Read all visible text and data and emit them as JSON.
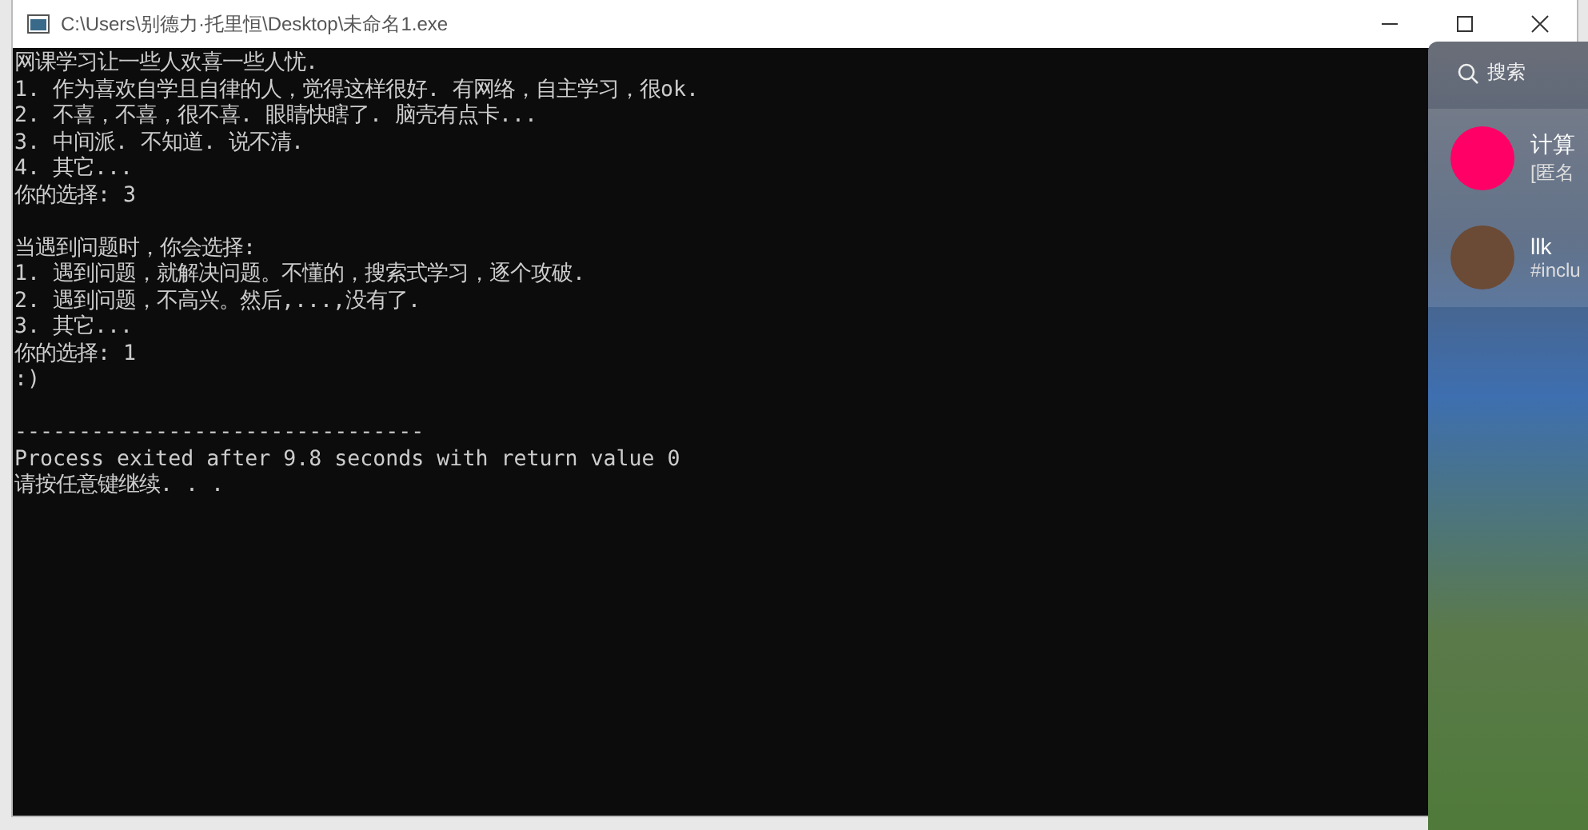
{
  "window": {
    "title": "C:\\Users\\别德力·托里恒\\Desktop\\未命名1.exe"
  },
  "console": {
    "blocks": [
      [
        "网课学习让一些人欢喜一些人忧.",
        "1. 作为喜欢自学且自律的人，觉得这样很好. 有网络，自主学习，很ok.",
        "2. 不喜，不喜，很不喜. 眼睛快瞎了. 脑壳有点卡...",
        "3. 中间派. 不知道. 说不清.",
        "4. 其它...",
        "你的选择: 3"
      ],
      [
        "当遇到问题时，你会选择:",
        "1. 遇到问题，就解决问题。不懂的，搜索式学习，逐个攻破.",
        "2. 遇到问题，不高兴。然后,...,没有了.",
        "3. 其它...",
        "你的选择: 1",
        ":)"
      ],
      [
        "--------------------------------",
        "Process exited after 9.8 seconds with return value 0",
        "请按任意键继续. . ."
      ]
    ]
  },
  "side_panel": {
    "search": "搜索",
    "chats": [
      {
        "kind": "dot",
        "color": "#ff0066",
        "name": "计算",
        "preview": "[匿名"
      },
      {
        "kind": "photo",
        "name": "llk",
        "preview": "#inclu"
      }
    ]
  }
}
